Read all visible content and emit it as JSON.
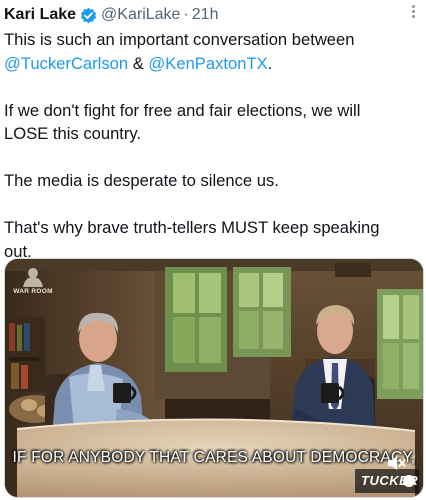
{
  "author": {
    "name": "Kari Lake",
    "handle": "@KariLake",
    "separator": "·",
    "time": "21h"
  },
  "tweet": {
    "line1_prefix": "This is such an important conversation between",
    "mention1": "@TuckerCarlson",
    "amp": " & ",
    "mention2": "@KenPaxtonTX",
    "line1_suffix": ".",
    "para2": "If we don't fight for free and fair elections, we will LOSE this country.",
    "para3": "The media is desperate to silence us.",
    "para4": "That's why brave truth-tellers MUST keep speaking out."
  },
  "video": {
    "subtitle": "IF FOR ANYBODY THAT CARES ABOUT DEMOCRACY,",
    "watermark_top_left": "WAR ROOM",
    "watermark_bottom_right": "TUCKER"
  },
  "icons": {
    "verified": "verified-badge-icon",
    "more": "more-options-icon",
    "mute": "volume-muted-icon"
  },
  "colors": {
    "text": "#0f1419",
    "secondary": "#536471",
    "link": "#1d9bf0",
    "verified": "#1d9bf0"
  }
}
